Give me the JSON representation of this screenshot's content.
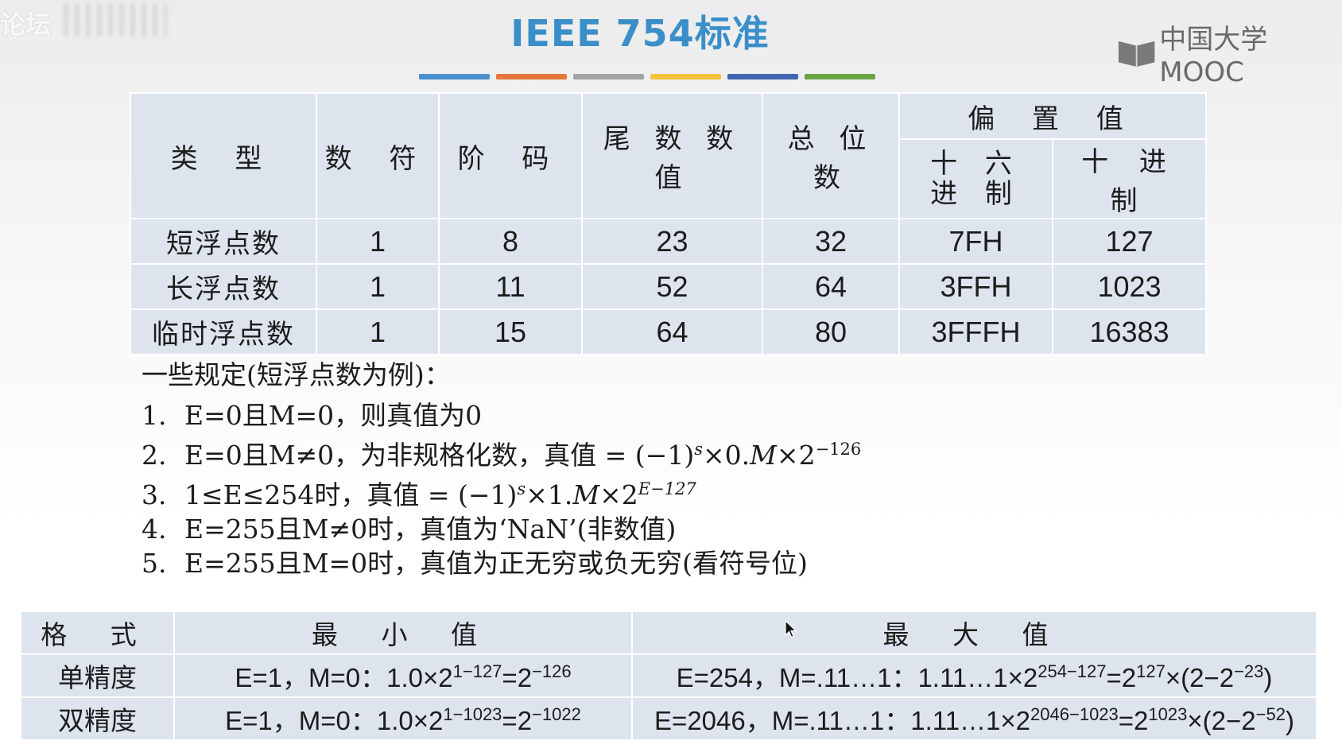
{
  "watermark": {
    "corner_text": "论坛"
  },
  "slide": {
    "title": "IEEE 754标准",
    "accent_colors": [
      "#4a8fcf",
      "#e8763a",
      "#a3a3a3",
      "#f4c23c",
      "#3f66b1",
      "#6aa544"
    ]
  },
  "logo": {
    "text": "中国大学MOOC",
    "icon": "mooc-book-icon"
  },
  "main_table": {
    "headers": {
      "type": "类 型",
      "sign": "数 符",
      "exponent": "阶 码",
      "mantissa": "尾 数 数 值",
      "total": "总 位 数",
      "bias": "偏 置 值",
      "hex": "十 六 进 制",
      "dec": "十 进 制"
    },
    "rows": [
      {
        "type": "短浮点数",
        "sign": "1",
        "exponent": "8",
        "mantissa": "23",
        "total": "32",
        "hex": "7FH",
        "dec": "127"
      },
      {
        "type": "长浮点数",
        "sign": "1",
        "exponent": "11",
        "mantissa": "52",
        "total": "64",
        "hex": "3FFH",
        "dec": "1023"
      },
      {
        "type": "临时浮点数",
        "sign": "1",
        "exponent": "15",
        "mantissa": "64",
        "total": "80",
        "hex": "3FFFH",
        "dec": "16383"
      }
    ]
  },
  "rules": {
    "heading": "一些规定(短浮点数为例)：",
    "items": [
      {
        "n": "1.",
        "text": "E=0且M=0，则真值为0"
      },
      {
        "n": "2.",
        "pre": "E=0且M≠0，为非规格化数，真值 = (−1)",
        "s": "s",
        "mid": "×0.",
        "m": "M",
        "post": "×2",
        "exp": "−126"
      },
      {
        "n": "3.",
        "pre": "1≤E≤254时，真值 = (−1)",
        "s": "s",
        "mid": "×1.",
        "m": "M",
        "post": "×2",
        "exp": "E−127"
      },
      {
        "n": "4.",
        "text": "E=255且M≠0时，真值为‘NaN’(非数值)"
      },
      {
        "n": "5.",
        "text": "E=255且M=0时，真值为正无穷或负无穷(看符号位)"
      }
    ]
  },
  "range_table": {
    "headers": {
      "format": "格 式",
      "min": "最 小 值",
      "max": "最 大 值"
    },
    "rows": [
      {
        "format": "单精度",
        "min_pre": "E=1，M=0：1.0×2",
        "min_exp1": "1−127",
        "min_eq": "=2",
        "min_exp2": "−126",
        "max_pre": "E=254，M=.11…1：1.11…1×2",
        "max_exp1": "254−127",
        "max_eq": "=2",
        "max_exp2": "127",
        "max_mul": "×(2−2",
        "max_exp3": "−23",
        "max_close": ")"
      },
      {
        "format": "双精度",
        "min_pre": "E=1，M=0：1.0×2",
        "min_exp1": "1−1023",
        "min_eq": "=2",
        "min_exp2": "−1022",
        "max_pre": "E=2046，M=.11…1：1.11…1×2",
        "max_exp1": "2046−1023",
        "max_eq": "=2",
        "max_exp2": "1023",
        "max_mul": "×(2−2",
        "max_exp3": "−52",
        "max_close": ")"
      }
    ]
  }
}
